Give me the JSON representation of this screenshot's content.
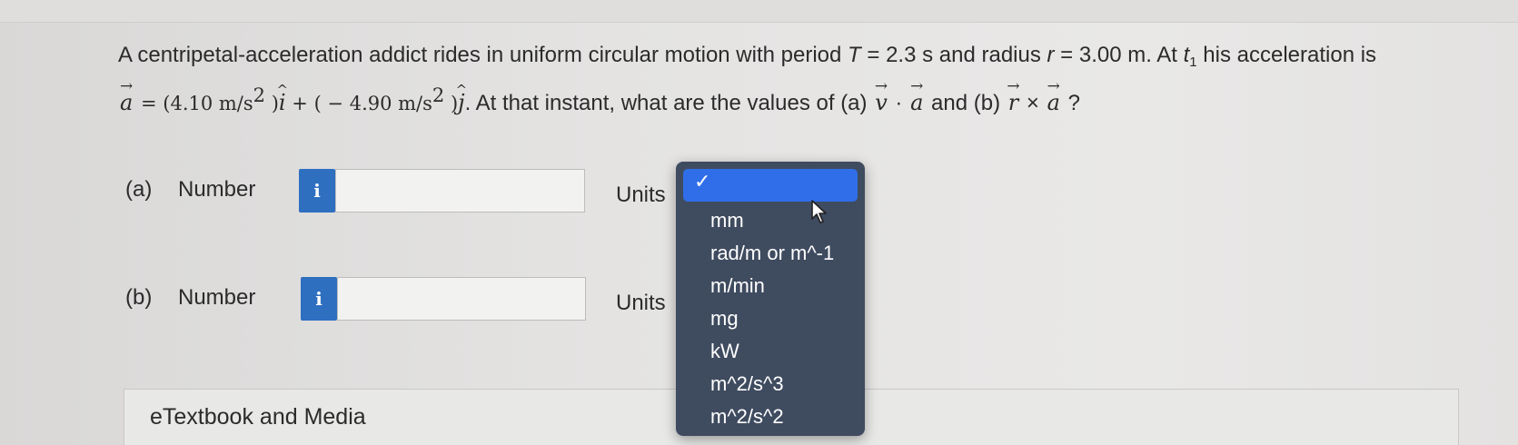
{
  "question": {
    "text_1": "A centripetal-acceleration addict rides in uniform circular motion with period ",
    "T_sym": "T",
    "T_val": " = 2.3 s and radius ",
    "r_sym": "r",
    "r_val": " = 3.00 m. At ",
    "t_sym": "t",
    "t_sub": "1",
    "text_2": " his acceleration is",
    "a_sym": "a",
    "eq": " = ",
    "comp1_open": "(4.10 m/s",
    "comp1_exp": "2",
    "comp1_close": " )",
    "i_hat": "i",
    "plus": " + ",
    "comp2_open": "( − 4.90 m/s",
    "comp2_exp": "2",
    "comp2_close": " )",
    "j_hat": "j",
    "text_3": ". At that instant, what are the values of (a) ",
    "v_sym": "v",
    "dot": " · ",
    "a_sym2": "a",
    "text_4": " and (b) ",
    "r_sym2": "r",
    "cross": " × ",
    "a_sym3": "a",
    "qmark": " ?"
  },
  "parts": [
    {
      "tag": "(a)",
      "number_label": "Number",
      "info_icon": "i",
      "number_value": "",
      "units_label": "Units"
    },
    {
      "tag": "(b)",
      "number_label": "Number",
      "info_icon": "i",
      "number_value": "",
      "units_label": "Units"
    }
  ],
  "units_dropdown": {
    "selected_check": "✓",
    "options": [
      "mm",
      "rad/m or m^-1",
      "m/min",
      "mg",
      "kW",
      "m^2/s^3",
      "m^2/s^2"
    ]
  },
  "etextbook": {
    "label": "eTextbook and Media"
  },
  "colors": {
    "info_button": "#2e6fc0",
    "dropdown_bg": "#3f4b5f",
    "dropdown_selected": "#2f6ee8"
  },
  "icons": {
    "info": "info-icon",
    "check": "checkmark-icon",
    "cursor": "mouse-pointer-icon"
  }
}
